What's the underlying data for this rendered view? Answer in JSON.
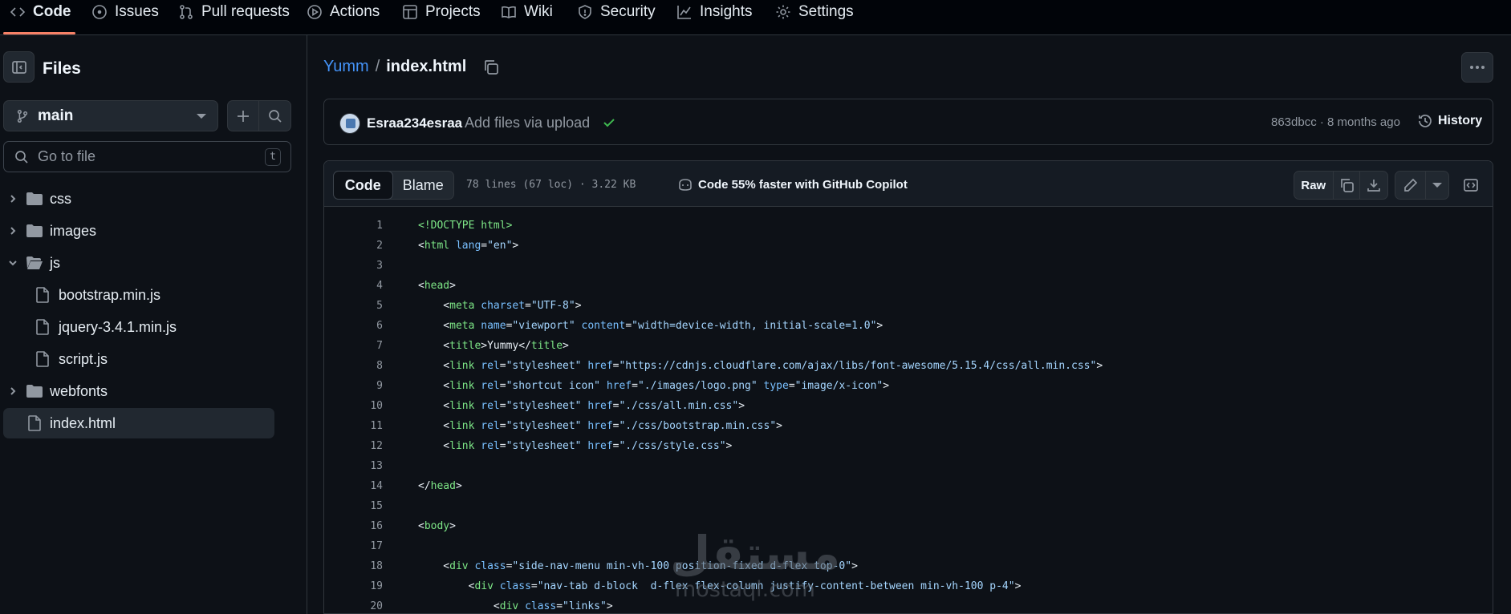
{
  "nav": {
    "tabs": [
      {
        "label": "Code",
        "icon": "code-icon"
      },
      {
        "label": "Issues",
        "icon": "issue-icon"
      },
      {
        "label": "Pull requests",
        "icon": "pull-request-icon"
      },
      {
        "label": "Actions",
        "icon": "play-icon"
      },
      {
        "label": "Projects",
        "icon": "table-icon"
      },
      {
        "label": "Wiki",
        "icon": "book-icon"
      },
      {
        "label": "Security",
        "icon": "shield-icon"
      },
      {
        "label": "Insights",
        "icon": "graph-icon"
      },
      {
        "label": "Settings",
        "icon": "gear-icon"
      }
    ],
    "active": "Code"
  },
  "sidebar": {
    "title": "Files",
    "branch": "main",
    "goto_placeholder": "Go to file",
    "goto_shortcut": "t",
    "tree": [
      {
        "name": "css",
        "type": "folder",
        "expanded": false
      },
      {
        "name": "images",
        "type": "folder",
        "expanded": false
      },
      {
        "name": "js",
        "type": "folder",
        "expanded": true
      },
      {
        "name": "bootstrap.min.js",
        "type": "file"
      },
      {
        "name": "jquery-3.4.1.min.js",
        "type": "file"
      },
      {
        "name": "script.js",
        "type": "file"
      },
      {
        "name": "webfonts",
        "type": "folder",
        "expanded": false
      },
      {
        "name": "index.html",
        "type": "file",
        "selected": true
      }
    ]
  },
  "breadcrumb": {
    "repo": "Yumm",
    "separator": "/",
    "file": "index.html"
  },
  "commit": {
    "author": "Esraa234esraa",
    "message": "Add files via upload",
    "meta": "863dbcc · 8 months ago",
    "history_label": "History"
  },
  "file_header": {
    "code_tab": "Code",
    "blame_tab": "Blame",
    "stats": "78 lines (67 loc) · 3.22 KB",
    "copilot": "Code 55% faster with GitHub Copilot",
    "raw_label": "Raw"
  },
  "code_lines": [
    {
      "n": "1",
      "parts": [
        [
          "t",
          "<!DOCTYPE html>"
        ]
      ]
    },
    {
      "n": "2",
      "parts": [
        [
          "p",
          "<"
        ],
        [
          "t",
          "html"
        ],
        [
          "p",
          " "
        ],
        [
          "a",
          "lang"
        ],
        [
          "p",
          "="
        ],
        [
          "s",
          "\"en\""
        ],
        [
          "p",
          ">"
        ]
      ]
    },
    {
      "n": "3",
      "parts": []
    },
    {
      "n": "4",
      "parts": [
        [
          "p",
          "<"
        ],
        [
          "t",
          "head"
        ],
        [
          "p",
          ">"
        ]
      ]
    },
    {
      "n": "5",
      "parts": [
        [
          "p",
          "    <"
        ],
        [
          "t",
          "meta"
        ],
        [
          "p",
          " "
        ],
        [
          "a",
          "charset"
        ],
        [
          "p",
          "="
        ],
        [
          "s",
          "\"UTF-8\""
        ],
        [
          "p",
          ">"
        ]
      ]
    },
    {
      "n": "6",
      "parts": [
        [
          "p",
          "    <"
        ],
        [
          "t",
          "meta"
        ],
        [
          "p",
          " "
        ],
        [
          "a",
          "name"
        ],
        [
          "p",
          "="
        ],
        [
          "s",
          "\"viewport\""
        ],
        [
          "p",
          " "
        ],
        [
          "a",
          "content"
        ],
        [
          "p",
          "="
        ],
        [
          "s",
          "\"width=device-width, initial-scale=1.0\""
        ],
        [
          "p",
          ">"
        ]
      ]
    },
    {
      "n": "7",
      "parts": [
        [
          "p",
          "    <"
        ],
        [
          "t",
          "title"
        ],
        [
          "p",
          ">Yummy</"
        ],
        [
          "t",
          "title"
        ],
        [
          "p",
          ">"
        ]
      ]
    },
    {
      "n": "8",
      "parts": [
        [
          "p",
          "    <"
        ],
        [
          "t",
          "link"
        ],
        [
          "p",
          " "
        ],
        [
          "a",
          "rel"
        ],
        [
          "p",
          "="
        ],
        [
          "s",
          "\"stylesheet\""
        ],
        [
          "p",
          " "
        ],
        [
          "a",
          "href"
        ],
        [
          "p",
          "="
        ],
        [
          "s",
          "\"https://cdnjs.cloudflare.com/ajax/libs/font-awesome/5.15.4/css/all.min.css\""
        ],
        [
          "p",
          ">"
        ]
      ]
    },
    {
      "n": "9",
      "parts": [
        [
          "p",
          "    <"
        ],
        [
          "t",
          "link"
        ],
        [
          "p",
          " "
        ],
        [
          "a",
          "rel"
        ],
        [
          "p",
          "="
        ],
        [
          "s",
          "\"shortcut icon\""
        ],
        [
          "p",
          " "
        ],
        [
          "a",
          "href"
        ],
        [
          "p",
          "="
        ],
        [
          "s",
          "\"./images/logo.png\""
        ],
        [
          "p",
          " "
        ],
        [
          "a",
          "type"
        ],
        [
          "p",
          "="
        ],
        [
          "s",
          "\"image/x-icon\""
        ],
        [
          "p",
          ">"
        ]
      ]
    },
    {
      "n": "10",
      "parts": [
        [
          "p",
          "    <"
        ],
        [
          "t",
          "link"
        ],
        [
          "p",
          " "
        ],
        [
          "a",
          "rel"
        ],
        [
          "p",
          "="
        ],
        [
          "s",
          "\"stylesheet\""
        ],
        [
          "p",
          " "
        ],
        [
          "a",
          "href"
        ],
        [
          "p",
          "="
        ],
        [
          "s",
          "\"./css/all.min.css\""
        ],
        [
          "p",
          ">"
        ]
      ]
    },
    {
      "n": "11",
      "parts": [
        [
          "p",
          "    <"
        ],
        [
          "t",
          "link"
        ],
        [
          "p",
          " "
        ],
        [
          "a",
          "rel"
        ],
        [
          "p",
          "="
        ],
        [
          "s",
          "\"stylesheet\""
        ],
        [
          "p",
          " "
        ],
        [
          "a",
          "href"
        ],
        [
          "p",
          "="
        ],
        [
          "s",
          "\"./css/bootstrap.min.css\""
        ],
        [
          "p",
          ">"
        ]
      ]
    },
    {
      "n": "12",
      "parts": [
        [
          "p",
          "    <"
        ],
        [
          "t",
          "link"
        ],
        [
          "p",
          " "
        ],
        [
          "a",
          "rel"
        ],
        [
          "p",
          "="
        ],
        [
          "s",
          "\"stylesheet\""
        ],
        [
          "p",
          " "
        ],
        [
          "a",
          "href"
        ],
        [
          "p",
          "="
        ],
        [
          "s",
          "\"./css/style.css\""
        ],
        [
          "p",
          ">"
        ]
      ]
    },
    {
      "n": "13",
      "parts": []
    },
    {
      "n": "14",
      "parts": [
        [
          "p",
          "</"
        ],
        [
          "t",
          "head"
        ],
        [
          "p",
          ">"
        ]
      ]
    },
    {
      "n": "15",
      "parts": []
    },
    {
      "n": "16",
      "parts": [
        [
          "p",
          "<"
        ],
        [
          "t",
          "body"
        ],
        [
          "p",
          ">"
        ]
      ]
    },
    {
      "n": "17",
      "parts": []
    },
    {
      "n": "18",
      "parts": [
        [
          "p",
          "    <"
        ],
        [
          "t",
          "div"
        ],
        [
          "p",
          " "
        ],
        [
          "a",
          "class"
        ],
        [
          "p",
          "="
        ],
        [
          "s",
          "\"side-nav-menu min-vh-100 position-fixed d-flex top-0\""
        ],
        [
          "p",
          ">"
        ]
      ]
    },
    {
      "n": "19",
      "parts": [
        [
          "p",
          "        <"
        ],
        [
          "t",
          "div"
        ],
        [
          "p",
          " "
        ],
        [
          "a",
          "class"
        ],
        [
          "p",
          "="
        ],
        [
          "s",
          "\"nav-tab d-block  d-flex flex-column justify-content-between min-vh-100 p-4\""
        ],
        [
          "p",
          ">"
        ]
      ]
    },
    {
      "n": "20",
      "parts": [
        [
          "p",
          "            <"
        ],
        [
          "t",
          "div"
        ],
        [
          "p",
          " "
        ],
        [
          "a",
          "class"
        ],
        [
          "p",
          "="
        ],
        [
          "s",
          "\"links\""
        ],
        [
          "p",
          ">"
        ]
      ]
    }
  ],
  "watermark": {
    "arabic": "مستقل",
    "latin": "mostaql.com"
  },
  "colors": {
    "bg": "#0d1117",
    "link": "#4493f8",
    "tag": "#7ee787",
    "attr": "#79c0ff",
    "string": "#a5d6ff",
    "success": "#3fb950",
    "active_tab": "#f78166"
  }
}
